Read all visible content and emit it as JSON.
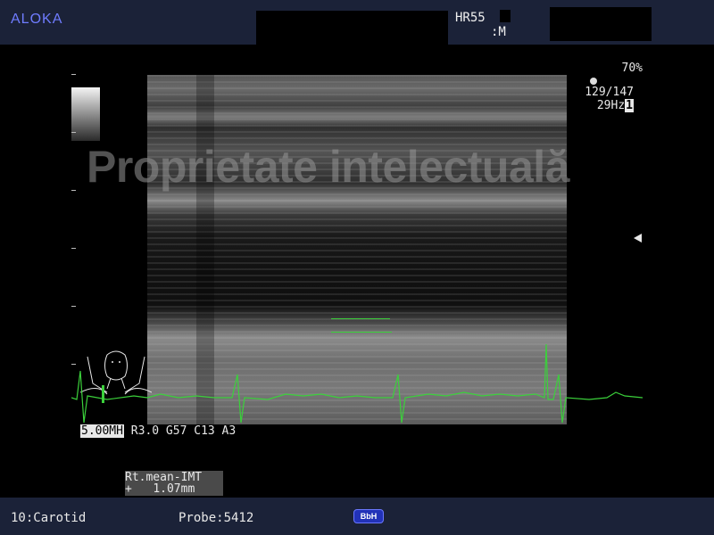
{
  "header": {
    "brand": "ALOKA",
    "heart_rate": "HR55",
    "heart_rate_unit": ":M"
  },
  "status": {
    "acoustic_power": "70%",
    "frame_info": "129/147",
    "frame_rate": "29Hz",
    "frame_rate_index": "1"
  },
  "watermark": "Proprietate intelectuală",
  "params": {
    "frequency": "5.00MH",
    "settings": "R3.0 G57 C13 A3"
  },
  "measurement": {
    "label": "Rt.mean-IMT",
    "cursor": "+",
    "value": "1.07mm"
  },
  "footer": {
    "preset": "10:Carotid",
    "probe": "Probe:5412",
    "badge": "BbH"
  },
  "colors": {
    "ecg_trace": "#3bd13b",
    "brand": "#6f7cff",
    "bars": "#1b2238"
  }
}
